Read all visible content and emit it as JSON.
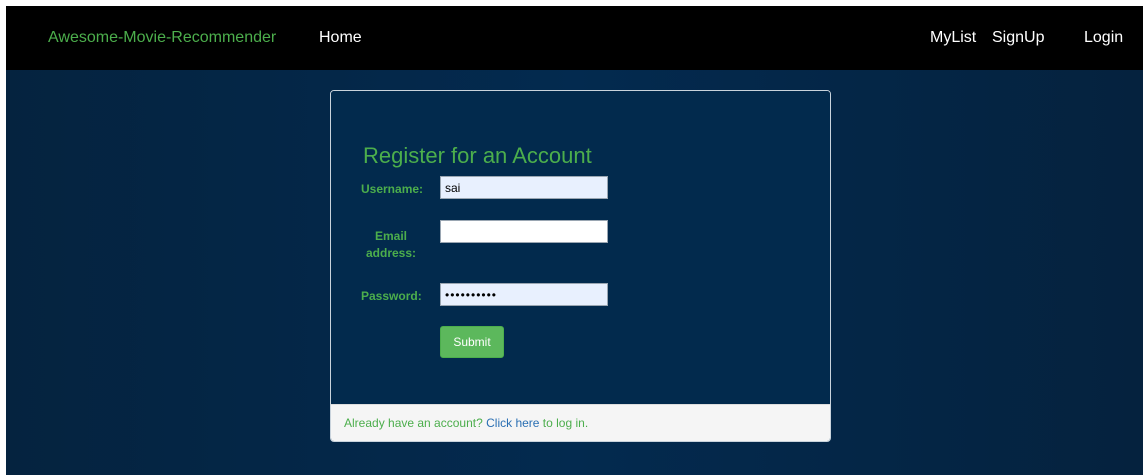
{
  "navbar": {
    "brand": "Awesome-Movie-Recommender",
    "home": "Home",
    "mylist": "MyList",
    "signup": "SignUp",
    "login": "Login"
  },
  "form": {
    "title": "Register for an Account",
    "username_label": "Username:",
    "username_value": "sai",
    "email_label": "Email address:",
    "email_value": "",
    "password_label": "Password:",
    "password_value": "sai1234567",
    "submit_label": "Submit"
  },
  "footer": {
    "text_before": "Already have an account? ",
    "link_text": "Click here",
    "text_after": " to log in."
  },
  "colors": {
    "navbar_bg": "#000000",
    "page_bg": "#032a4f",
    "accent_green": "#4cae4c",
    "button_green": "#5cb85c",
    "link_blue": "#2a6fb3",
    "footer_bg": "#f5f5f5"
  }
}
